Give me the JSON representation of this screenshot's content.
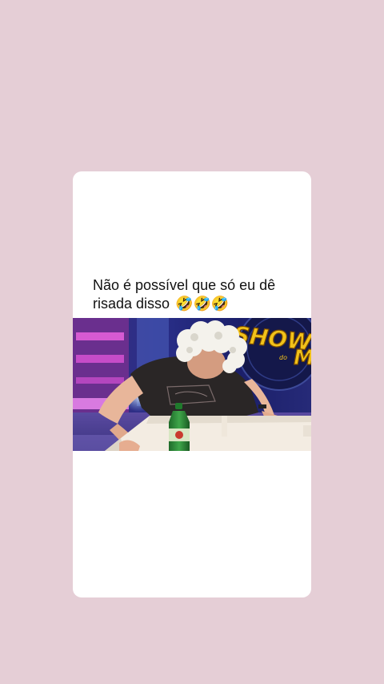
{
  "post": {
    "caption": "Não é possível que só eu dê risada disso",
    "caption_emojis": "🤣🤣🤣",
    "media": {
      "type": "video-frame",
      "logo_text": "SHOW",
      "logo_text_2": "M",
      "logo_small": "do"
    }
  },
  "colors": {
    "page_background": "#e5ced6",
    "card_background": "#ffffff",
    "text": "#111111",
    "logo_yellow": "#f2c21a"
  },
  "icons": {
    "emoji": "rolling-on-the-floor-laughing"
  }
}
